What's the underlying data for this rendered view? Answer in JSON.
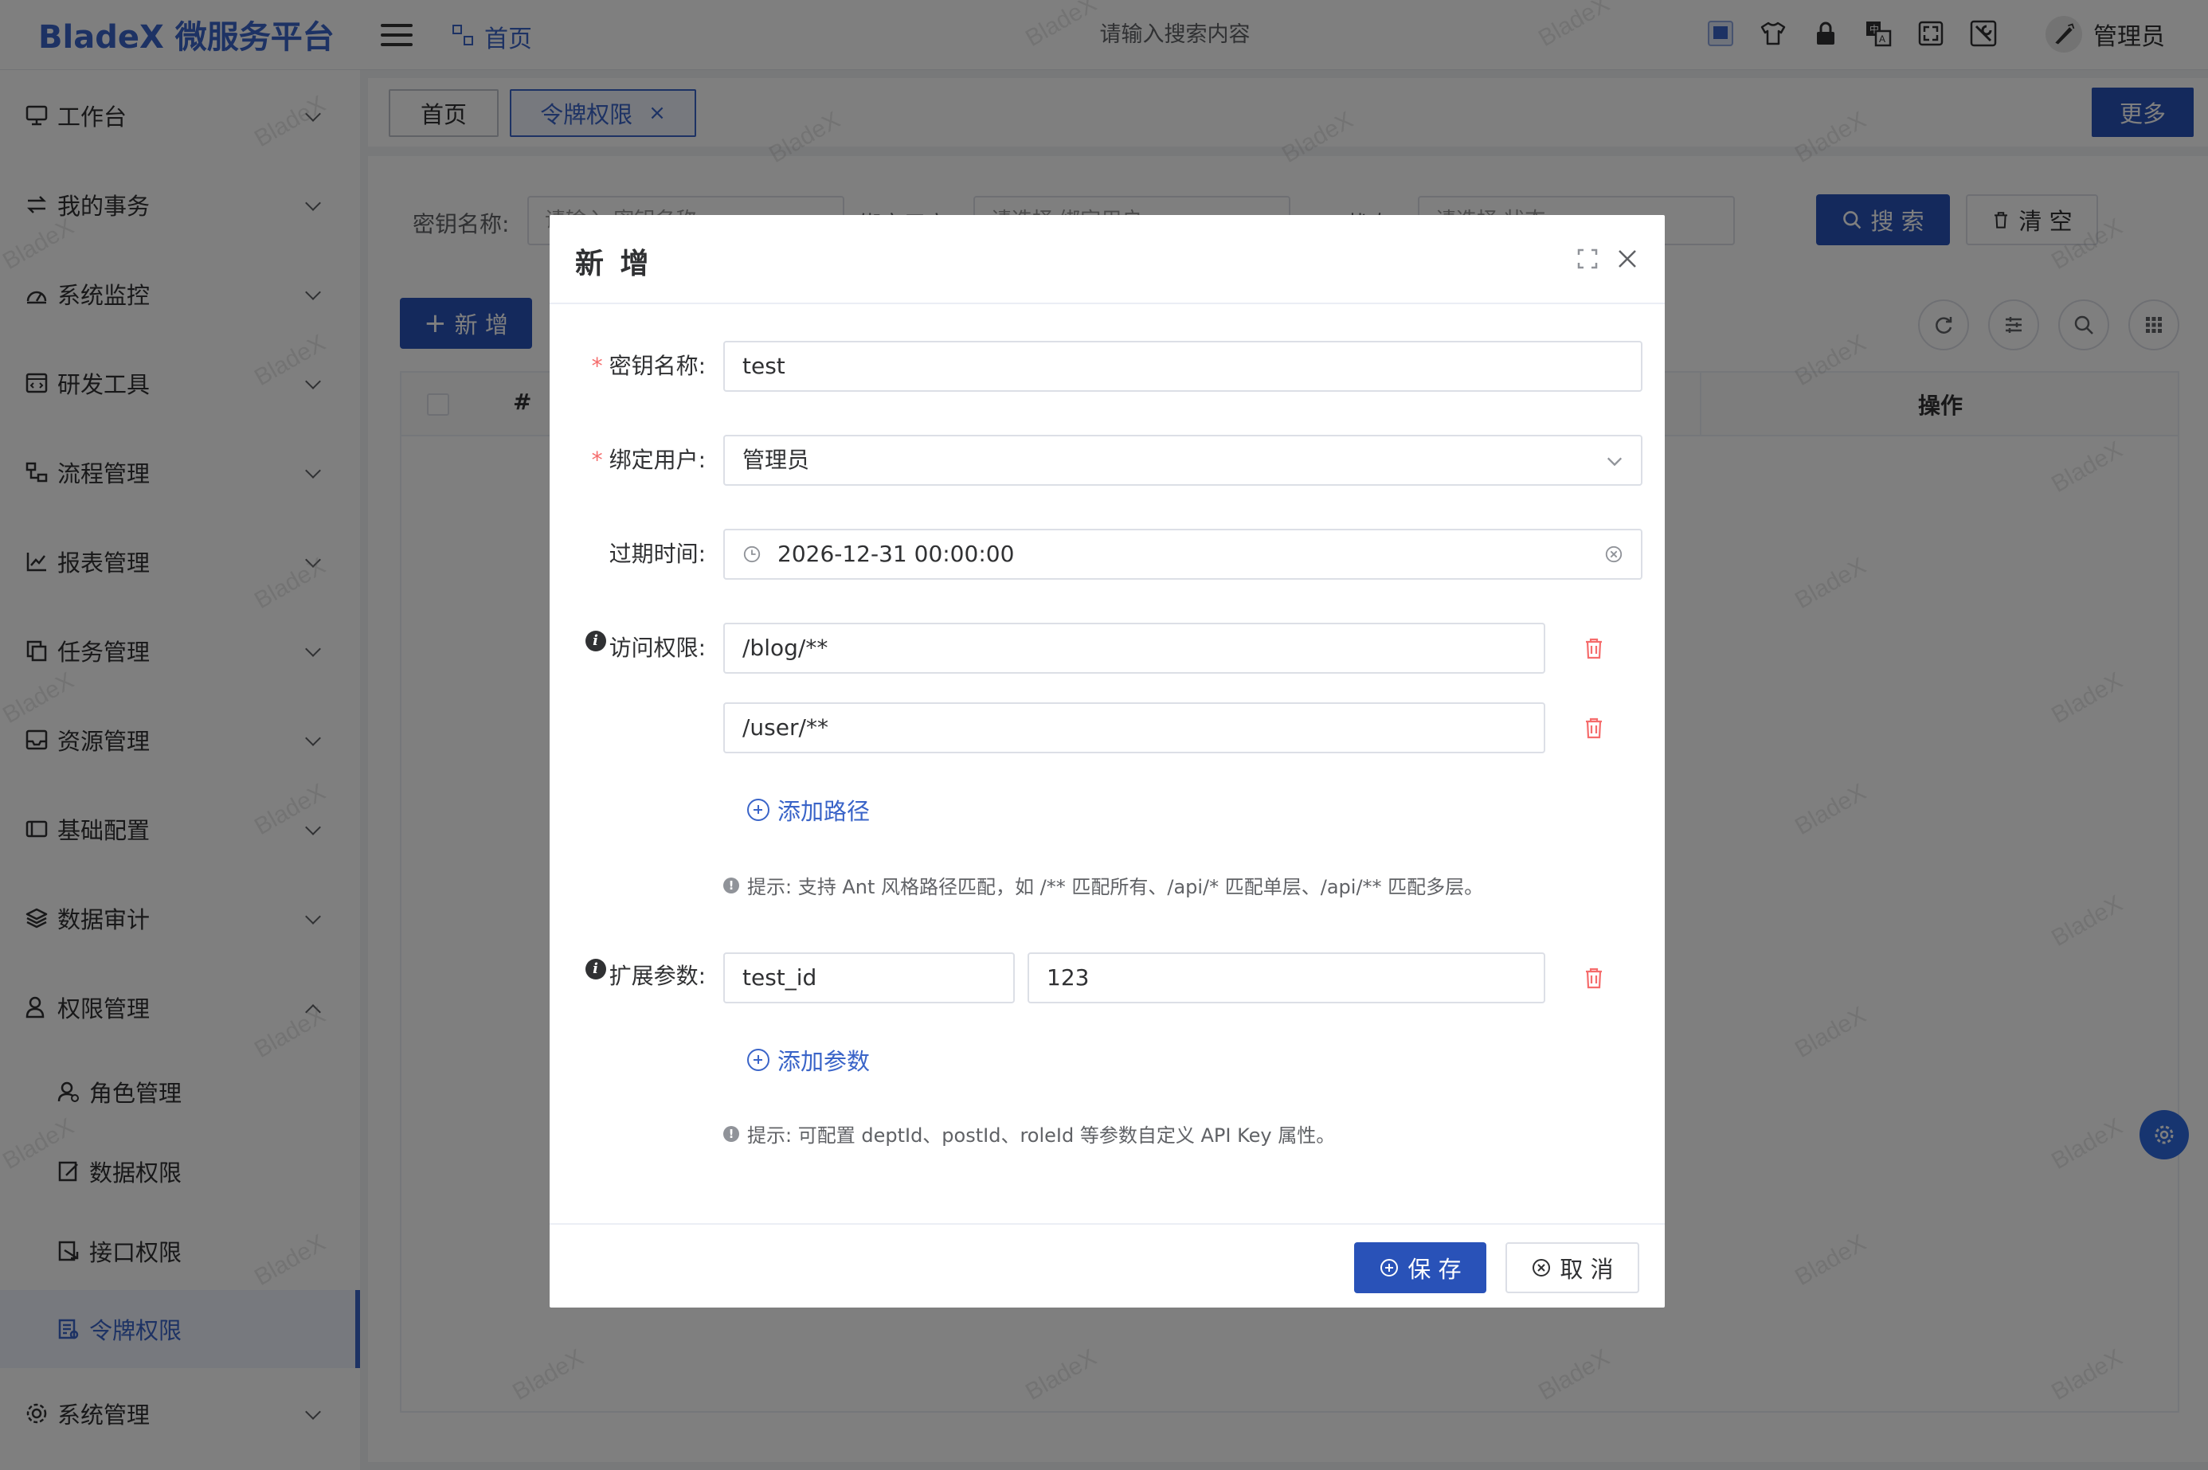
{
  "header": {
    "logo": "BladeX 微服务平台",
    "breadcrumb": "首页",
    "search_placeholder": "请输入搜索内容",
    "user_name": "管理员"
  },
  "sidebar": {
    "items": [
      {
        "label": "工作台",
        "icon": "monitor-icon"
      },
      {
        "label": "我的事务",
        "icon": "transfer-icon"
      },
      {
        "label": "系统监控",
        "icon": "gauge-icon"
      },
      {
        "label": "研发工具",
        "icon": "code-window-icon"
      },
      {
        "label": "流程管理",
        "icon": "flow-icon"
      },
      {
        "label": "报表管理",
        "icon": "chart-icon"
      },
      {
        "label": "任务管理",
        "icon": "tasks-icon"
      },
      {
        "label": "资源管理",
        "icon": "inbox-icon"
      },
      {
        "label": "基础配置",
        "icon": "credit-card-icon"
      },
      {
        "label": "数据审计",
        "icon": "layers-icon"
      },
      {
        "label": "权限管理",
        "icon": "user-key-icon"
      },
      {
        "label": "系统管理",
        "icon": "settings-icon"
      }
    ],
    "sub_items": [
      {
        "label": "角色管理",
        "icon": "role-icon"
      },
      {
        "label": "数据权限",
        "icon": "edit-doc-icon"
      },
      {
        "label": "接口权限",
        "icon": "api-icon"
      },
      {
        "label": "令牌权限",
        "icon": "token-icon"
      }
    ]
  },
  "tabs": [
    {
      "label": "首页"
    },
    {
      "label": "令牌权限"
    }
  ],
  "more_label": "更多",
  "filters": {
    "key_name_label": "密钥名称:",
    "key_name_placeholder": "请输入 密钥名称",
    "bind_user_label": "绑定用户:",
    "bind_user_placeholder": "请选择 绑定用户",
    "status_label": "状态:",
    "status_placeholder": "请选择 状态",
    "search_label": "搜 索",
    "clear_label": "清 空"
  },
  "toolbar": {
    "add_label": "新 增"
  },
  "table": {
    "columns": [
      "#",
      "操作"
    ]
  },
  "watermark": "BladeX",
  "dialog": {
    "title": "新 增",
    "key_name_label": "密钥名称:",
    "key_name_value": "test",
    "bind_user_label": "绑定用户:",
    "bind_user_value": "管理员",
    "expire_label": "过期时间:",
    "expire_value": "2026-12-31 00:00:00",
    "access_label": "访问权限:",
    "paths": [
      "/blog/**",
      "/user/**"
    ],
    "add_path_label": "添加路径",
    "path_hint": "提示: 支持 Ant 风格路径匹配，如 /** 匹配所有、/api/* 匹配单层、/api/** 匹配多层。",
    "ext_label": "扩展参数:",
    "ext_key": "test_id",
    "ext_value": "123",
    "add_param_label": "添加参数",
    "param_hint": "提示: 可配置 deptId、postId、roleId 等参数自定义 API Key 属性。",
    "save_label": "保 存",
    "cancel_label": "取 消"
  },
  "colors": {
    "primary": "#2952b8",
    "accent": "#3a64c8",
    "danger": "#f56c6c"
  }
}
